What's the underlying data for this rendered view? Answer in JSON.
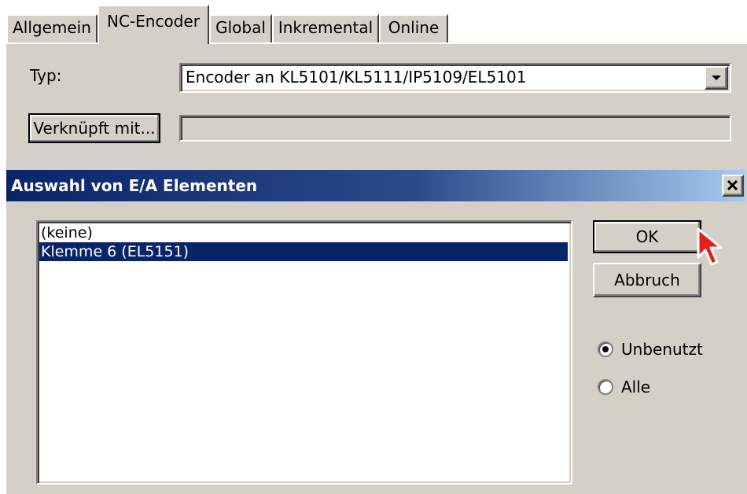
{
  "tabs": [
    {
      "label": "Allgemein"
    },
    {
      "label": "NC-Encoder"
    },
    {
      "label": "Global"
    },
    {
      "label": "Inkremental"
    },
    {
      "label": "Online"
    }
  ],
  "form": {
    "type_label": "Typ:",
    "type_value": "Encoder an KL5101/KL5111/IP5109/EL5101",
    "linked_button": "Verknüpft mit...",
    "linked_value": ""
  },
  "dialog": {
    "title": "Auswahl von E/A Elementen",
    "list_items": [
      "(keine)",
      "Klemme 6 (EL5151)"
    ],
    "selected_index": 1,
    "ok_label": "OK",
    "cancel_label": "Abbruch",
    "radio_unused": "Unbenutzt",
    "radio_all": "Alle",
    "radio_selected": "Unbenutzt"
  },
  "colors": {
    "title_bar_start": "#0a246a",
    "title_bar_end": "#a6caf0",
    "selection": "#0a246a",
    "face": "#d4d0c8"
  }
}
